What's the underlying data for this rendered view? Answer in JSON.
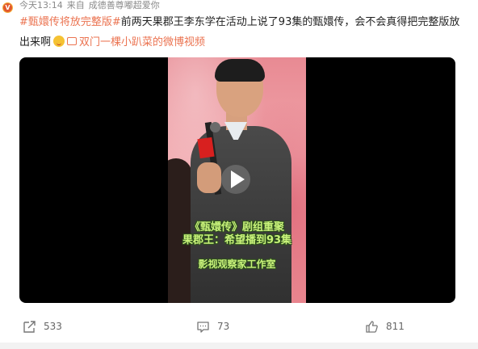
{
  "avatar_badge": "V",
  "meta": {
    "time": "今天13:14",
    "source_prefix": "来自",
    "source": "成德善尊嘟超爱你"
  },
  "post": {
    "topic": "#甄嬛传将放完整版#",
    "text_1": "前两天果郡王李东学在活动上说了93集的甄嬛传，会不会真得把完整版放出来啊",
    "emoji": "wink-emoji",
    "video_link": "双门一棵小趴菜的微博视频"
  },
  "video": {
    "caption_line_1": "《甄嬛传》剧组重聚",
    "caption_line_2": "果郡王：希望播到93集",
    "caption_line_3": "影视观察家工作室",
    "colors": {
      "background": "#e88a93",
      "caption": "#c8f27a"
    }
  },
  "actions": {
    "forward_count": "533",
    "comment_count": "73",
    "like_count": "811"
  },
  "colors": {
    "accent": "#eb7350",
    "text": "#222222",
    "muted": "#8a8a8a"
  }
}
